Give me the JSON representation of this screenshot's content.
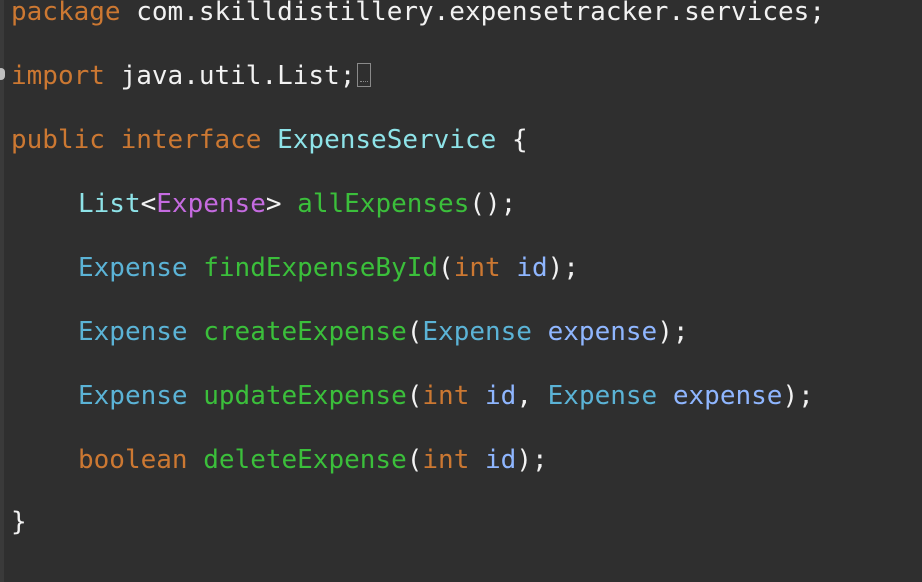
{
  "code": {
    "package_line": {
      "keyword": "package",
      "name": "com.skilldistillery.expensetracker.services;"
    },
    "import_line": {
      "keyword": "import",
      "name": "java.util.List;"
    },
    "interface_decl": {
      "kw_public": "public",
      "kw_interface": "interface",
      "name": "ExpenseService",
      "open_brace": "{",
      "close_brace": "}"
    },
    "methods": [
      {
        "return_type": "List",
        "type_param": "Expense",
        "name": "allExpenses",
        "signature_tail": "();"
      },
      {
        "return_type": "Expense",
        "name": "findExpenseById",
        "param_type": "int",
        "param_name": "id"
      },
      {
        "return_type": "Expense",
        "name": "createExpense",
        "param_type": "Expense",
        "param_name": "expense"
      },
      {
        "return_type": "Expense",
        "name": "updateExpense",
        "param1_type": "int",
        "param1_name": "id",
        "param2_type": "Expense",
        "param2_name": "expense"
      },
      {
        "return_type": "boolean",
        "name": "deleteExpense",
        "param_type": "int",
        "param_name": "id"
      }
    ]
  },
  "colors": {
    "background": "#2f2f2f",
    "keyword": "#cc7832",
    "type": "#5bb3d6",
    "interface_name": "#8ee3e8",
    "generic": "#c56be0",
    "method": "#3bbf3b",
    "parameter": "#8fb6ff",
    "plain": "#f2f2f2"
  }
}
